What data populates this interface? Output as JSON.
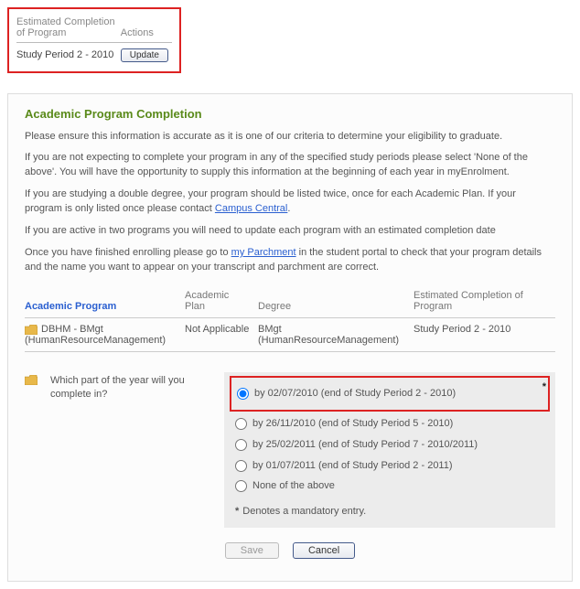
{
  "top": {
    "col1_label": "Estimated Completion of Program",
    "col2_label": "Actions",
    "value": "Study Period 2 - 2010",
    "update_label": "Update"
  },
  "panel": {
    "title": "Academic Program Completion",
    "p1": "Please ensure this information is accurate as it is one of our criteria to determine your eligibility to graduate.",
    "p2": "If you are not expecting to complete your program in any of the specified study periods please select 'None of the above'. You will have the opportunity to supply this information at the beginning of each year in myEnrolment.",
    "p3_a": "If you are studying a double degree, your program should be listed twice, once for each Academic Plan. If your program is only listed once please contact ",
    "p3_link": "Campus Central",
    "p3_b": ".",
    "p4": "If you are active in two programs you will need to update each program with an estimated completion date",
    "p5_a": "Once you have finished enrolling please go to ",
    "p5_link": "my Parchment",
    "p5_b": " in the student portal to check that your program details and the name you want to appear on your transcript and parchment are correct."
  },
  "table": {
    "h1": "Academic Program",
    "h2": "Academic Plan",
    "h3": "Degree",
    "h4": "Estimated Completion of Program",
    "row": {
      "program": "DBHM - BMgt (HumanResourceManagement)",
      "plan": "Not Applicable",
      "degree": "BMgt (HumanResourceManagement)",
      "completion": "Study Period 2 - 2010"
    }
  },
  "question": {
    "label": "Which part of the year will you complete in?",
    "options": [
      "by 02/07/2010 (end of Study Period 2 - 2010)",
      "by 26/11/2010 (end of Study Period 5 - 2010)",
      "by 25/02/2011 (end of Study Period 7 - 2010/2011)",
      "by 01/07/2011 (end of Study Period 2 - 2011)",
      "None of the above"
    ],
    "mandatory": "Denotes a mandatory entry."
  },
  "buttons": {
    "save": "Save",
    "cancel": "Cancel"
  }
}
